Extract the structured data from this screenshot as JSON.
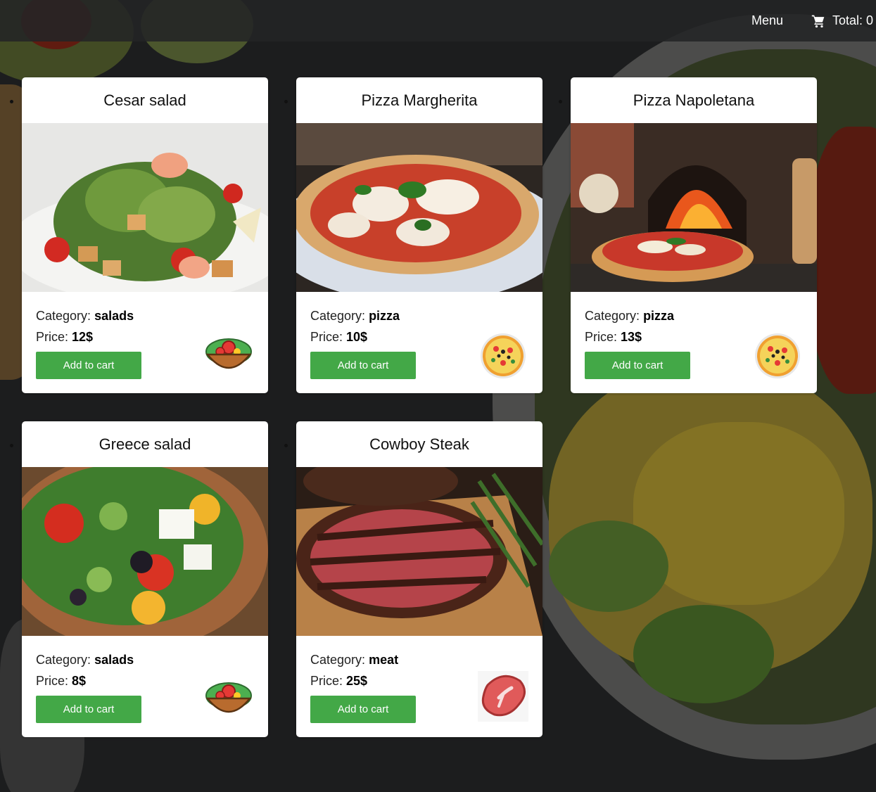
{
  "header": {
    "menu_label": "Menu",
    "cart_label": "Total: 0",
    "cart_icon": "shopping-cart-icon"
  },
  "labels": {
    "category": "Category:",
    "price": "Price:",
    "add_to_cart": "Add to cart"
  },
  "colors": {
    "button": "#43a847",
    "header_bg": "#232426"
  },
  "products": [
    {
      "title": "Cesar salad",
      "category": "salads",
      "price": "12$",
      "icon": "salad-bowl-icon"
    },
    {
      "title": "Pizza Margherita",
      "category": "pizza",
      "price": "10$",
      "icon": "pizza-icon"
    },
    {
      "title": "Pizza Napoletana",
      "category": "pizza",
      "price": "13$",
      "icon": "pizza-icon"
    },
    {
      "title": "Greece salad",
      "category": "salads",
      "price": "8$",
      "icon": "salad-bowl-icon"
    },
    {
      "title": "Cowboy Steak",
      "category": "meat",
      "price": "25$",
      "icon": "steak-icon"
    }
  ]
}
